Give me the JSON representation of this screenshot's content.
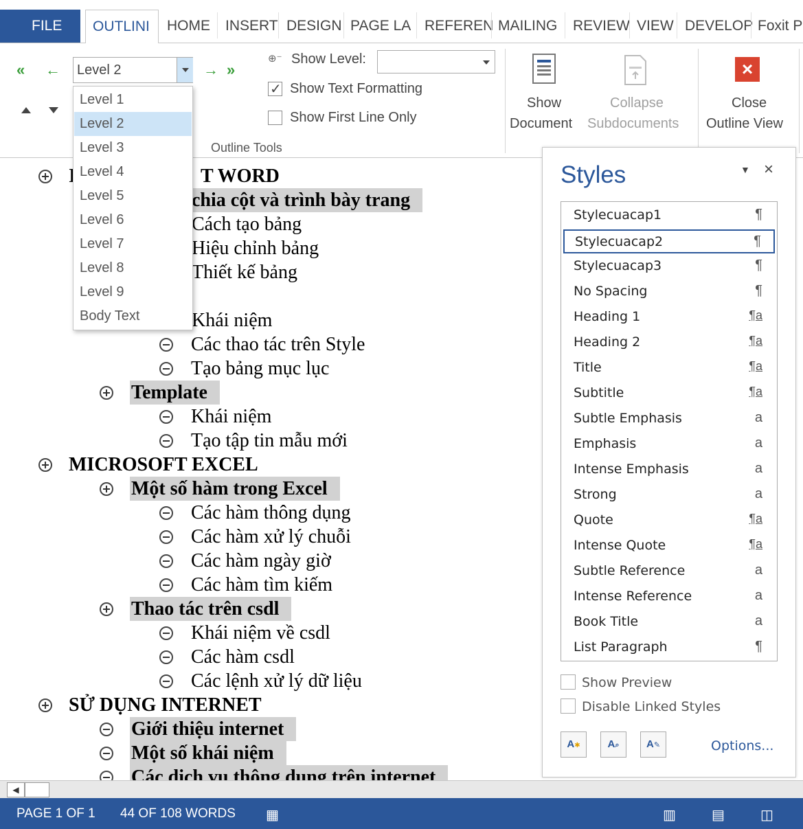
{
  "tabs": {
    "file": "FILE",
    "outlining": "OUTLINI",
    "home": "HOME",
    "insert": "INSERT",
    "design": "DESIGN",
    "page_layout": "PAGE LA",
    "references": "REFEREN",
    "mailings": "MAILING",
    "review": "REVIEW",
    "view": "VIEW",
    "developer": "DEVELOP",
    "foxit": "Foxit P"
  },
  "ribbon": {
    "level_combo_value": "Level 2",
    "show_level_label": "Show Level:",
    "show_text_formatting": "Show Text Formatting",
    "show_first_line_only": "Show First Line Only",
    "outline_tools_label": "Outline Tools",
    "show_document": [
      "Show",
      "Document"
    ],
    "collapse_subdocuments": [
      "Collapse",
      "Subdocuments"
    ],
    "close_outline_view": [
      "Close",
      "Outline View"
    ]
  },
  "level_options": [
    "Level 1",
    "Level 2",
    "Level 3",
    "Level 4",
    "Level 5",
    "Level 6",
    "Level 7",
    "Level 8",
    "Level 9",
    "Body Text"
  ],
  "document": {
    "lines": [
      {
        "t": "I",
        "suffix": "T WORD"
      },
      {
        "t": "chia cột và trình bày trang"
      },
      {
        "t": "Cách tạo bảng"
      },
      {
        "t": "Hiệu chỉnh bảng"
      },
      {
        "t": "Thiết kế bảng"
      },
      {
        "t": "Khái niệm"
      },
      {
        "t": "Các thao tác trên Style"
      },
      {
        "t": "Tạo bảng mục lục"
      },
      {
        "t": "Template"
      },
      {
        "t": "Khái niệm"
      },
      {
        "t": "Tạo tập tin mẫu mới"
      },
      {
        "t": "MICROSOFT EXCEL"
      },
      {
        "t": "Một số hàm trong Excel"
      },
      {
        "t": "Các hàm thông dụng"
      },
      {
        "t": "Các hàm xử lý chuỗi"
      },
      {
        "t": "Các hàm ngày giờ"
      },
      {
        "t": "Các hàm tìm kiếm"
      },
      {
        "t": "Thao tác trên csdl"
      },
      {
        "t": "Khái niệm về csdl"
      },
      {
        "t": "Các hàm csdl"
      },
      {
        "t": "Các lệnh xử lý dữ liệu"
      },
      {
        "t": "SỬ DỤNG INTERNET"
      },
      {
        "t": "Giới thiệu internet"
      },
      {
        "t": "Một số khái niệm"
      },
      {
        "t": "Các dịch vụ thông dụng trên internet"
      }
    ]
  },
  "styles_pane": {
    "title": "Styles",
    "items": [
      {
        "name": "Stylecuacap1",
        "glyph": "¶"
      },
      {
        "name": "Stylecuacap2",
        "glyph": "¶"
      },
      {
        "name": "Stylecuacap3",
        "glyph": "¶"
      },
      {
        "name": "No Spacing",
        "glyph": "¶"
      },
      {
        "name": "Heading 1",
        "glyph": "¶a"
      },
      {
        "name": "Heading 2",
        "glyph": "¶a"
      },
      {
        "name": "Title",
        "glyph": "¶a"
      },
      {
        "name": "Subtitle",
        "glyph": "¶a"
      },
      {
        "name": "Subtle Emphasis",
        "glyph": "a"
      },
      {
        "name": "Emphasis",
        "glyph": "a"
      },
      {
        "name": "Intense Emphasis",
        "glyph": "a"
      },
      {
        "name": "Strong",
        "glyph": "a"
      },
      {
        "name": "Quote",
        "glyph": "¶a"
      },
      {
        "name": "Intense Quote",
        "glyph": "¶a"
      },
      {
        "name": "Subtle Reference",
        "glyph": "a"
      },
      {
        "name": "Intense Reference",
        "glyph": "a"
      },
      {
        "name": "Book Title",
        "glyph": "a"
      },
      {
        "name": "List Paragraph",
        "glyph": "¶"
      }
    ],
    "show_preview": "Show Preview",
    "disable_linked": "Disable Linked Styles",
    "options": "Options..."
  },
  "status": {
    "page": "PAGE 1 OF 1",
    "words": "44 OF 108 WORDS"
  },
  "colors": {
    "accent": "#2b579a",
    "close_red": "#d9432f",
    "outline_shade": "#d2d2d2"
  }
}
